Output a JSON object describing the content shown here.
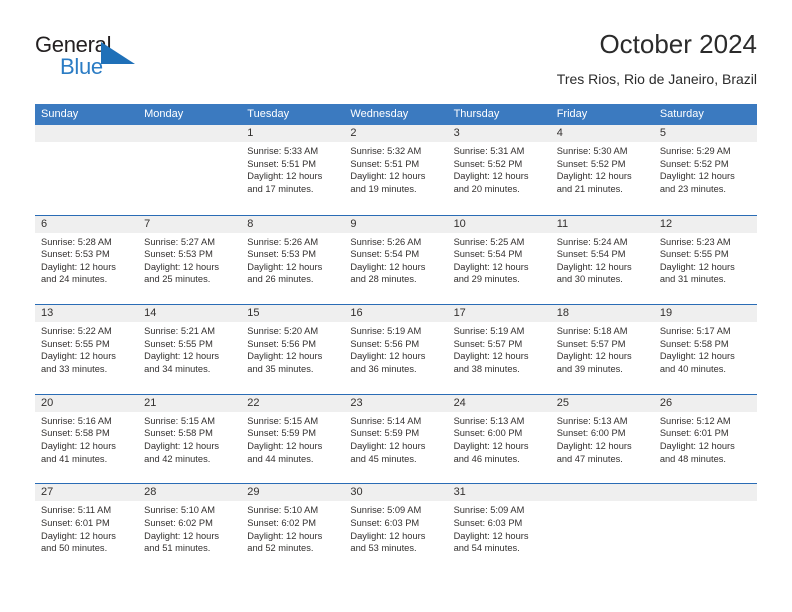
{
  "brand": {
    "name_top": "General",
    "name_bottom": "Blue",
    "triangle_icon": "blue-triangle-logo-mark",
    "accent_color": "#1f70b8",
    "text_color": "#231f20"
  },
  "header": {
    "title": "October 2024",
    "subtitle": "Tres Rios, Rio de Janeiro, Brazil"
  },
  "calendar": {
    "header_bg": "#3b7ac0",
    "row_divider": "#2a6cb5",
    "date_band_bg": "#efefef",
    "weekdays": [
      "Sunday",
      "Monday",
      "Tuesday",
      "Wednesday",
      "Thursday",
      "Friday",
      "Saturday"
    ],
    "weeks": [
      [
        {
          "day": "",
          "lines": []
        },
        {
          "day": "",
          "lines": []
        },
        {
          "day": "1",
          "lines": [
            "Sunrise: 5:33 AM",
            "Sunset: 5:51 PM",
            "Daylight: 12 hours",
            "and 17 minutes."
          ]
        },
        {
          "day": "2",
          "lines": [
            "Sunrise: 5:32 AM",
            "Sunset: 5:51 PM",
            "Daylight: 12 hours",
            "and 19 minutes."
          ]
        },
        {
          "day": "3",
          "lines": [
            "Sunrise: 5:31 AM",
            "Sunset: 5:52 PM",
            "Daylight: 12 hours",
            "and 20 minutes."
          ]
        },
        {
          "day": "4",
          "lines": [
            "Sunrise: 5:30 AM",
            "Sunset: 5:52 PM",
            "Daylight: 12 hours",
            "and 21 minutes."
          ]
        },
        {
          "day": "5",
          "lines": [
            "Sunrise: 5:29 AM",
            "Sunset: 5:52 PM",
            "Daylight: 12 hours",
            "and 23 minutes."
          ]
        }
      ],
      [
        {
          "day": "6",
          "lines": [
            "Sunrise: 5:28 AM",
            "Sunset: 5:53 PM",
            "Daylight: 12 hours",
            "and 24 minutes."
          ]
        },
        {
          "day": "7",
          "lines": [
            "Sunrise: 5:27 AM",
            "Sunset: 5:53 PM",
            "Daylight: 12 hours",
            "and 25 minutes."
          ]
        },
        {
          "day": "8",
          "lines": [
            "Sunrise: 5:26 AM",
            "Sunset: 5:53 PM",
            "Daylight: 12 hours",
            "and 26 minutes."
          ]
        },
        {
          "day": "9",
          "lines": [
            "Sunrise: 5:26 AM",
            "Sunset: 5:54 PM",
            "Daylight: 12 hours",
            "and 28 minutes."
          ]
        },
        {
          "day": "10",
          "lines": [
            "Sunrise: 5:25 AM",
            "Sunset: 5:54 PM",
            "Daylight: 12 hours",
            "and 29 minutes."
          ]
        },
        {
          "day": "11",
          "lines": [
            "Sunrise: 5:24 AM",
            "Sunset: 5:54 PM",
            "Daylight: 12 hours",
            "and 30 minutes."
          ]
        },
        {
          "day": "12",
          "lines": [
            "Sunrise: 5:23 AM",
            "Sunset: 5:55 PM",
            "Daylight: 12 hours",
            "and 31 minutes."
          ]
        }
      ],
      [
        {
          "day": "13",
          "lines": [
            "Sunrise: 5:22 AM",
            "Sunset: 5:55 PM",
            "Daylight: 12 hours",
            "and 33 minutes."
          ]
        },
        {
          "day": "14",
          "lines": [
            "Sunrise: 5:21 AM",
            "Sunset: 5:55 PM",
            "Daylight: 12 hours",
            "and 34 minutes."
          ]
        },
        {
          "day": "15",
          "lines": [
            "Sunrise: 5:20 AM",
            "Sunset: 5:56 PM",
            "Daylight: 12 hours",
            "and 35 minutes."
          ]
        },
        {
          "day": "16",
          "lines": [
            "Sunrise: 5:19 AM",
            "Sunset: 5:56 PM",
            "Daylight: 12 hours",
            "and 36 minutes."
          ]
        },
        {
          "day": "17",
          "lines": [
            "Sunrise: 5:19 AM",
            "Sunset: 5:57 PM",
            "Daylight: 12 hours",
            "and 38 minutes."
          ]
        },
        {
          "day": "18",
          "lines": [
            "Sunrise: 5:18 AM",
            "Sunset: 5:57 PM",
            "Daylight: 12 hours",
            "and 39 minutes."
          ]
        },
        {
          "day": "19",
          "lines": [
            "Sunrise: 5:17 AM",
            "Sunset: 5:58 PM",
            "Daylight: 12 hours",
            "and 40 minutes."
          ]
        }
      ],
      [
        {
          "day": "20",
          "lines": [
            "Sunrise: 5:16 AM",
            "Sunset: 5:58 PM",
            "Daylight: 12 hours",
            "and 41 minutes."
          ]
        },
        {
          "day": "21",
          "lines": [
            "Sunrise: 5:15 AM",
            "Sunset: 5:58 PM",
            "Daylight: 12 hours",
            "and 42 minutes."
          ]
        },
        {
          "day": "22",
          "lines": [
            "Sunrise: 5:15 AM",
            "Sunset: 5:59 PM",
            "Daylight: 12 hours",
            "and 44 minutes."
          ]
        },
        {
          "day": "23",
          "lines": [
            "Sunrise: 5:14 AM",
            "Sunset: 5:59 PM",
            "Daylight: 12 hours",
            "and 45 minutes."
          ]
        },
        {
          "day": "24",
          "lines": [
            "Sunrise: 5:13 AM",
            "Sunset: 6:00 PM",
            "Daylight: 12 hours",
            "and 46 minutes."
          ]
        },
        {
          "day": "25",
          "lines": [
            "Sunrise: 5:13 AM",
            "Sunset: 6:00 PM",
            "Daylight: 12 hours",
            "and 47 minutes."
          ]
        },
        {
          "day": "26",
          "lines": [
            "Sunrise: 5:12 AM",
            "Sunset: 6:01 PM",
            "Daylight: 12 hours",
            "and 48 minutes."
          ]
        }
      ],
      [
        {
          "day": "27",
          "lines": [
            "Sunrise: 5:11 AM",
            "Sunset: 6:01 PM",
            "Daylight: 12 hours",
            "and 50 minutes."
          ]
        },
        {
          "day": "28",
          "lines": [
            "Sunrise: 5:10 AM",
            "Sunset: 6:02 PM",
            "Daylight: 12 hours",
            "and 51 minutes."
          ]
        },
        {
          "day": "29",
          "lines": [
            "Sunrise: 5:10 AM",
            "Sunset: 6:02 PM",
            "Daylight: 12 hours",
            "and 52 minutes."
          ]
        },
        {
          "day": "30",
          "lines": [
            "Sunrise: 5:09 AM",
            "Sunset: 6:03 PM",
            "Daylight: 12 hours",
            "and 53 minutes."
          ]
        },
        {
          "day": "31",
          "lines": [
            "Sunrise: 5:09 AM",
            "Sunset: 6:03 PM",
            "Daylight: 12 hours",
            "and 54 minutes."
          ]
        },
        {
          "day": "",
          "lines": []
        },
        {
          "day": "",
          "lines": []
        }
      ]
    ]
  }
}
